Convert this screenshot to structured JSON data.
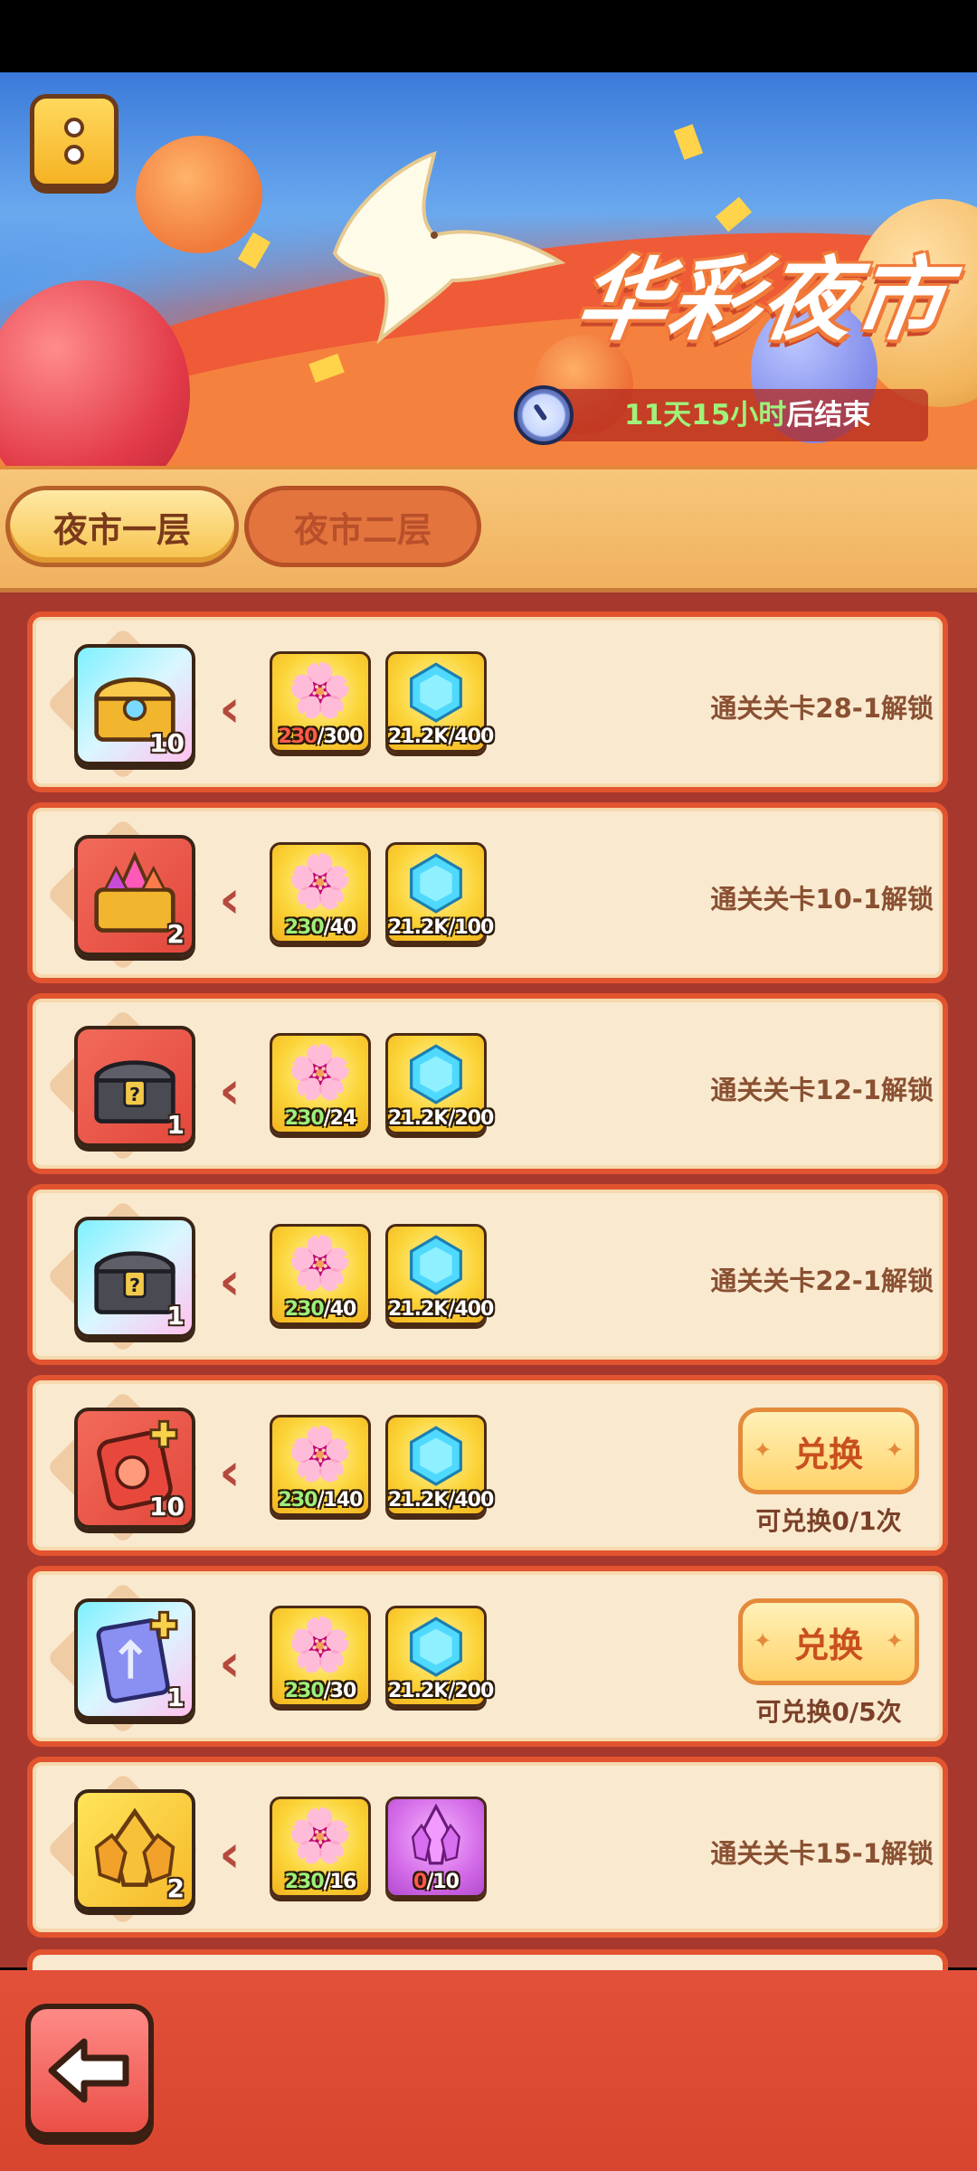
{
  "event": {
    "title": "华彩夜市",
    "timer_days": "11天15小时",
    "timer_suffix": "后结束"
  },
  "tabs": [
    {
      "label": "夜市一层",
      "selected": true
    },
    {
      "label": "夜市二层",
      "selected": false
    }
  ],
  "icons": {
    "menu": "menu-icon",
    "clock": "clock-icon",
    "back": "back-arrow-icon",
    "currency_1": "peony-flower-icon",
    "currency_2": "blue-gem-icon",
    "currency_3": "purple-crystal-icon"
  },
  "colors": {
    "accent_red": "#e2542f",
    "panel_cream": "#f9e9cf",
    "enough_green": "#9df07a",
    "lacking_red": "#ff5a4a"
  },
  "shop_items": [
    {
      "item_icon": "golden-chest-icon",
      "item_count": "10",
      "cost1_have": "230",
      "cost1_need": "/300",
      "cost1_enough": false,
      "cost2_have": "21.2K",
      "cost2_need": "/400",
      "status": "通关关卡28-1解锁"
    },
    {
      "item_icon": "crystal-chest-icon",
      "item_count": "2",
      "cost1_have": "230",
      "cost1_need": "/40",
      "cost1_enough": true,
      "cost2_have": "21.2K",
      "cost2_need": "/100",
      "status": "通关关卡10-1解锁"
    },
    {
      "item_icon": "mystery-iron-chest-red-icon",
      "item_count": "1",
      "cost1_have": "230",
      "cost1_need": "/24",
      "cost1_enough": true,
      "cost2_have": "21.2K",
      "cost2_need": "/200",
      "status": "通关关卡12-1解锁"
    },
    {
      "item_icon": "mystery-iron-chest-icon",
      "item_count": "1",
      "cost1_have": "230",
      "cost1_need": "/40",
      "cost1_enough": true,
      "cost2_have": "21.2K",
      "cost2_need": "/400",
      "status": "通关关卡22-1解锁"
    },
    {
      "item_icon": "red-potion-icon",
      "item_count": "10",
      "cost1_have": "230",
      "cost1_need": "/140",
      "cost1_enough": true,
      "cost2_have": "21.2K",
      "cost2_need": "/400",
      "button": "兑换",
      "limit": "可兑换0/1次"
    },
    {
      "item_icon": "blue-spellbook-icon",
      "item_count": "1",
      "cost1_have": "230",
      "cost1_need": "/30",
      "cost1_enough": true,
      "cost2_have": "21.2K",
      "cost2_need": "/200",
      "button": "兑换",
      "limit": "可兑换0/5次"
    },
    {
      "item_icon": "gold-crystal-icon",
      "item_count": "2",
      "cost1_have": "230",
      "cost1_need": "/16",
      "cost1_enough": true,
      "cost2_have": "0",
      "cost2_need": "/10",
      "cost2_currency": "purple-crystal-icon",
      "status": "通关关卡15-1解锁"
    }
  ]
}
